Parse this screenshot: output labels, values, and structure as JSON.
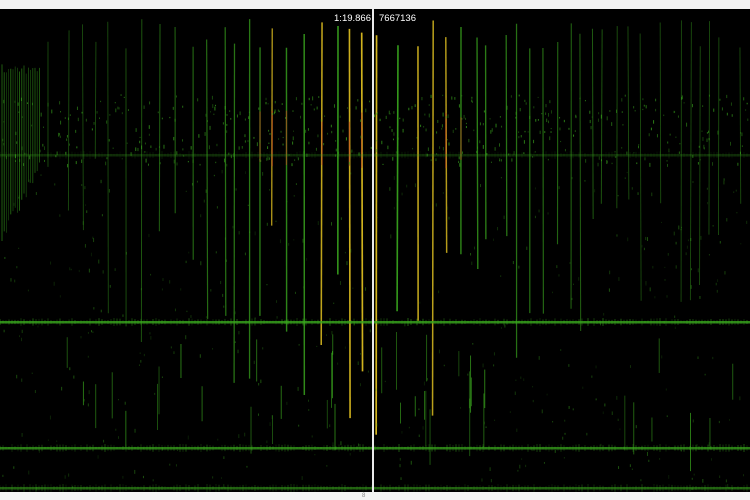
{
  "readout": {
    "time": "1:19.866",
    "sample": "7667136"
  },
  "bottom_marker": "8",
  "colors": {
    "background": "#000000",
    "signal_low": "#3aa81e",
    "signal_high": "#e0c020",
    "signal_hot": "#c04020",
    "playhead": "#eaeaea"
  }
}
